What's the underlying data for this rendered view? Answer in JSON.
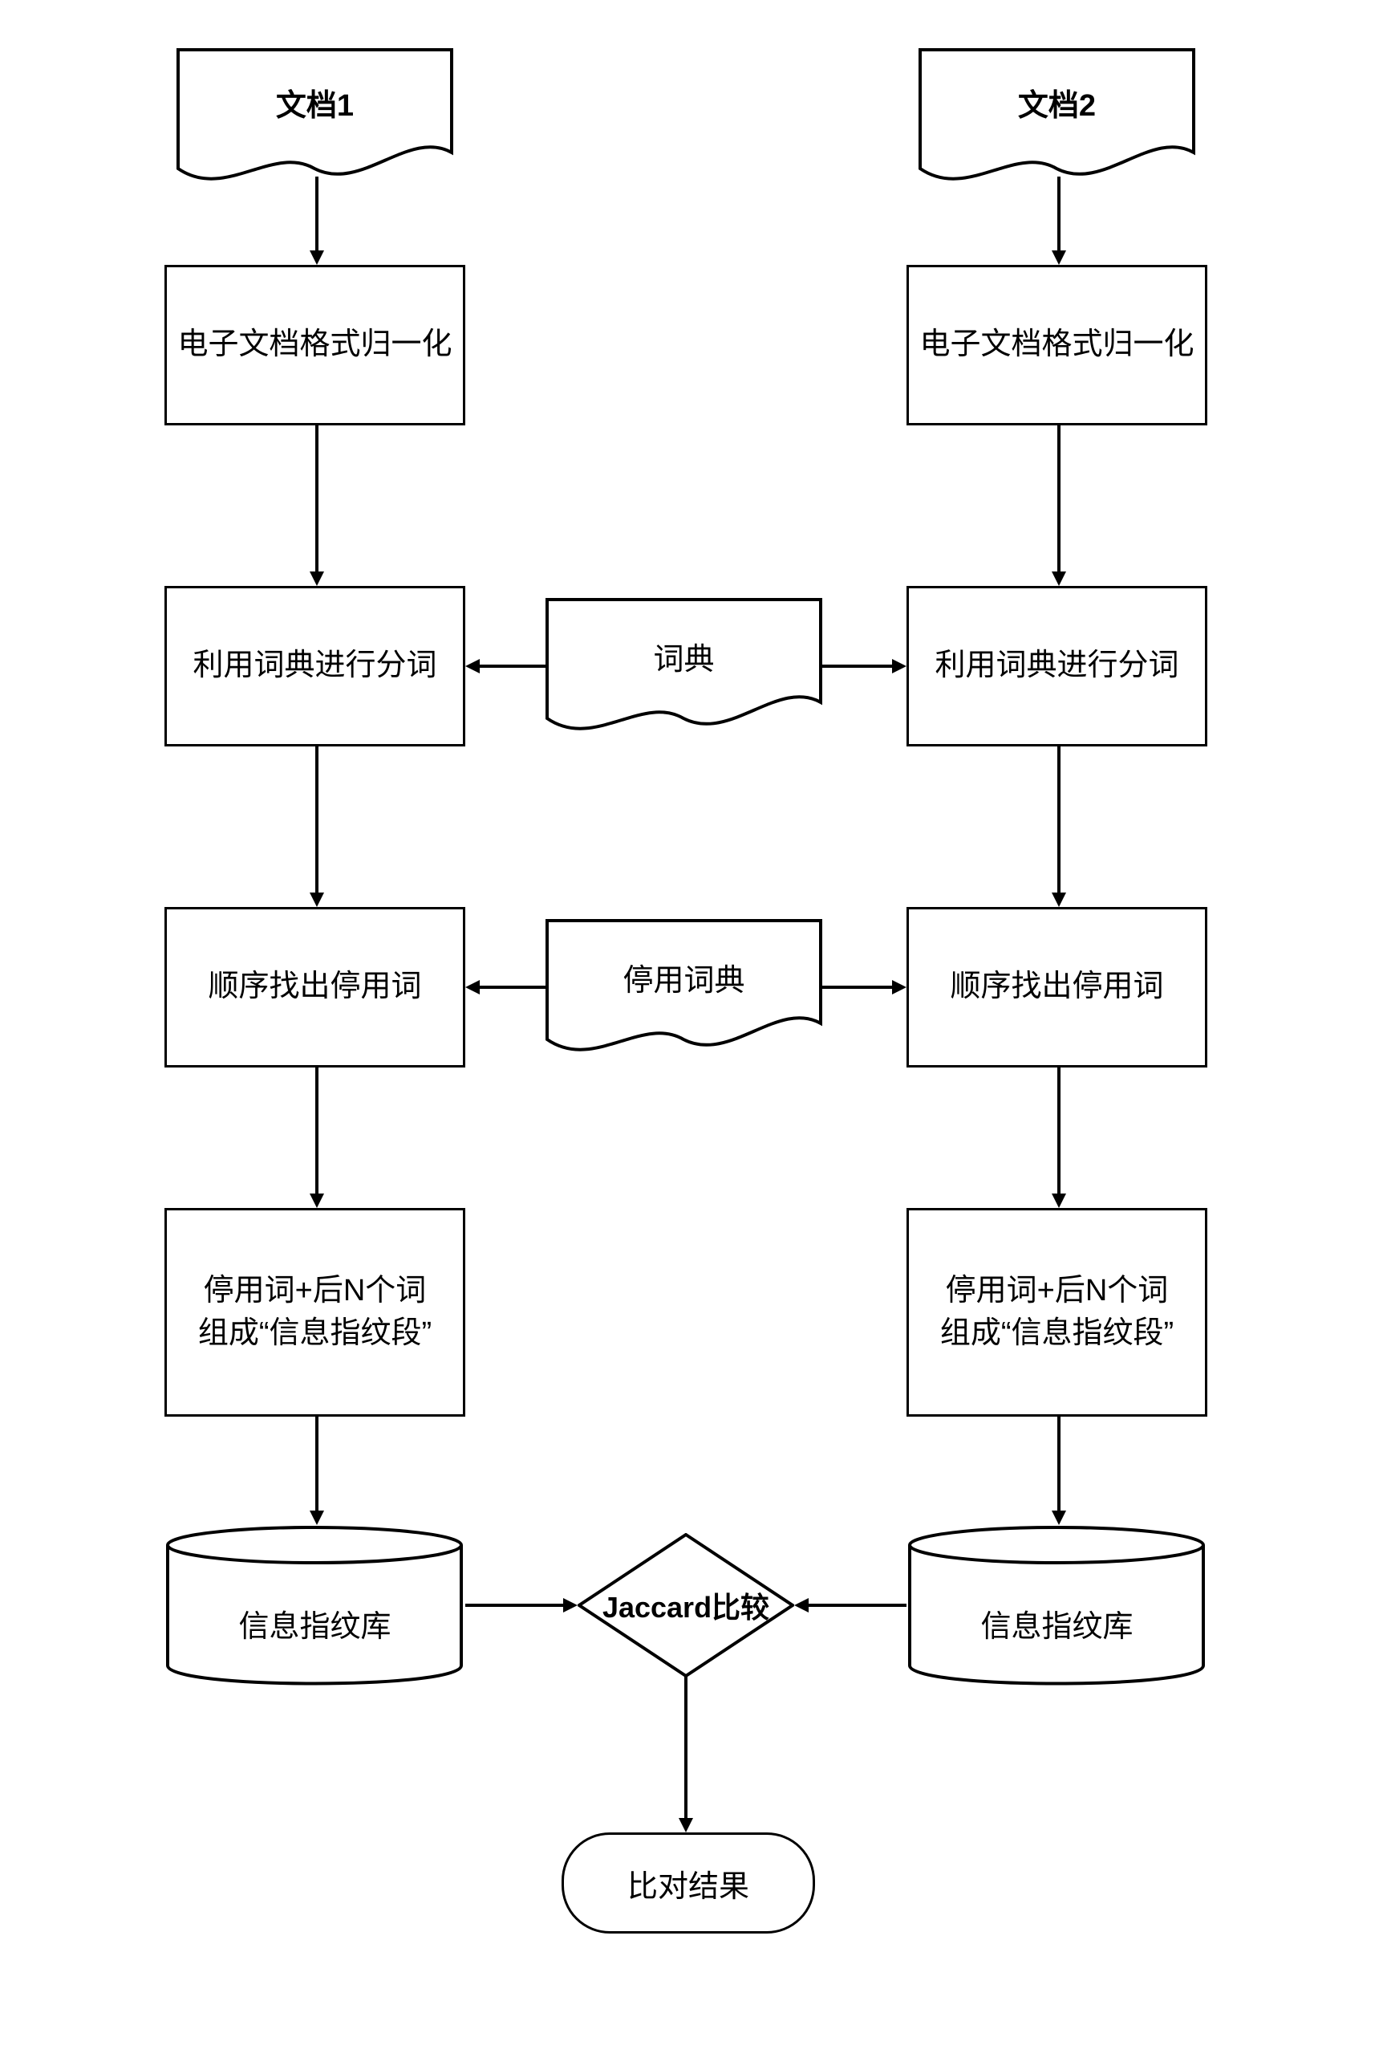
{
  "doc1": "文档1",
  "doc2": "文档2",
  "normalize_left": "电子文档格式归一化",
  "normalize_right": "电子文档格式归一化",
  "tokenize_left": "利用词典进行分词",
  "tokenize_right": "利用词典进行分词",
  "dict": "词典",
  "stopword_left": "顺序找出停用词",
  "stopword_right": "顺序找出停用词",
  "stopdict": "停用词典",
  "fingerprint_left": "停用词+后N个词\n组成“信息指纹段”",
  "fingerprint_right": "停用词+后N个词\n组成“信息指纹段”",
  "fprepo_left": "信息指纹库",
  "fprepo_right": "信息指纹库",
  "jaccard": "Jaccard比较",
  "result": "比对结果",
  "chart_data": {
    "type": "flowchart",
    "nodes": [
      {
        "id": "doc1",
        "type": "document",
        "label": "文档1"
      },
      {
        "id": "doc2",
        "type": "document",
        "label": "文档2"
      },
      {
        "id": "norm1",
        "type": "process",
        "label": "电子文档格式归一化"
      },
      {
        "id": "norm2",
        "type": "process",
        "label": "电子文档格式归一化"
      },
      {
        "id": "dict",
        "type": "document",
        "label": "词典"
      },
      {
        "id": "tok1",
        "type": "process",
        "label": "利用词典进行分词"
      },
      {
        "id": "tok2",
        "type": "process",
        "label": "利用词典进行分词"
      },
      {
        "id": "stop1",
        "type": "process",
        "label": "顺序找出停用词"
      },
      {
        "id": "stop2",
        "type": "process",
        "label": "顺序找出停用词"
      },
      {
        "id": "stopdict",
        "type": "document",
        "label": "停用词典"
      },
      {
        "id": "fp1",
        "type": "process",
        "label": "停用词+后N个词 组成“信息指纹段”"
      },
      {
        "id": "fp2",
        "type": "process",
        "label": "停用词+后N个词 组成“信息指纹段”"
      },
      {
        "id": "repo1",
        "type": "database",
        "label": "信息指纹库"
      },
      {
        "id": "repo2",
        "type": "database",
        "label": "信息指纹库"
      },
      {
        "id": "jaccard",
        "type": "decision",
        "label": "Jaccard比较"
      },
      {
        "id": "result",
        "type": "terminator",
        "label": "比对结果"
      }
    ],
    "edges": [
      {
        "from": "doc1",
        "to": "norm1"
      },
      {
        "from": "doc2",
        "to": "norm2"
      },
      {
        "from": "norm1",
        "to": "tok1"
      },
      {
        "from": "norm2",
        "to": "tok2"
      },
      {
        "from": "dict",
        "to": "tok1"
      },
      {
        "from": "dict",
        "to": "tok2"
      },
      {
        "from": "tok1",
        "to": "stop1"
      },
      {
        "from": "tok2",
        "to": "stop2"
      },
      {
        "from": "stopdict",
        "to": "stop1"
      },
      {
        "from": "stopdict",
        "to": "stop2"
      },
      {
        "from": "stop1",
        "to": "fp1"
      },
      {
        "from": "stop2",
        "to": "fp2"
      },
      {
        "from": "fp1",
        "to": "repo1"
      },
      {
        "from": "fp2",
        "to": "repo2"
      },
      {
        "from": "repo1",
        "to": "jaccard"
      },
      {
        "from": "repo2",
        "to": "jaccard"
      },
      {
        "from": "jaccard",
        "to": "result"
      }
    ]
  }
}
